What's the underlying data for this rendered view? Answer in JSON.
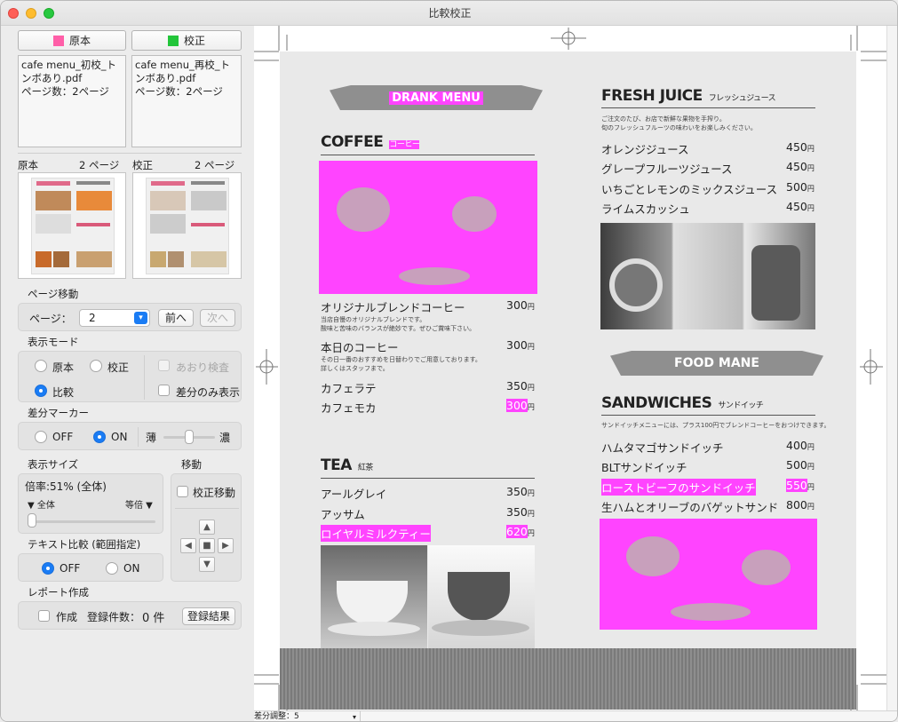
{
  "window": {
    "title": "比較校正"
  },
  "files": {
    "original": {
      "button": "原本",
      "color": "#ff5fa8",
      "name": "cafe menu_初校_トンボあり.pdf",
      "pages": "ページ数：2ページ",
      "thumb_label": "原本",
      "thumb_pages": "2 ページ"
    },
    "revised": {
      "button": "校正",
      "color": "#22c53a",
      "name": "cafe menu_再校_トンボあり.pdf",
      "pages": "ページ数：2ページ",
      "thumb_label": "校正",
      "thumb_pages": "2 ページ"
    }
  },
  "page_move": {
    "title": "ページ移動",
    "label": "ページ：",
    "value": "2",
    "prev": "前へ",
    "next": "次へ"
  },
  "display_mode": {
    "title": "表示モード",
    "original": "原本",
    "revised": "校正",
    "flip": "あおり検査",
    "compare": "比較",
    "diff_only": "差分のみ表示"
  },
  "diff_marker": {
    "title": "差分マーカー",
    "off": "OFF",
    "on": "ON",
    "light": "薄",
    "dark": "濃",
    "level": 0.5
  },
  "display_size": {
    "title": "表示サイズ",
    "zoom": "倍率:51% (全体)",
    "fit": "▼ 全体",
    "actual": "等倍 ▼",
    "level": 0.0
  },
  "move": {
    "title": "移動",
    "revised_move": "校正移動"
  },
  "text_compare": {
    "title": "テキスト比較 (範囲指定)",
    "off": "OFF",
    "on": "ON"
  },
  "report": {
    "title": "レポート作成",
    "create": "作成",
    "count_label": "登録件数：",
    "count": "0 件",
    "result": "登録結果"
  },
  "status": {
    "diff_adjust": "差分調整：5"
  },
  "menu": {
    "drink_banner": "DRANK MENU",
    "coffee": {
      "title": "COFFEE",
      "sub": "コーヒー",
      "items": [
        {
          "name": "オリジナルブレンドコーヒー",
          "price": "300",
          "desc": "当店自慢のオリジナルブレンドです。\n酸味と苦味のバランスが絶妙です。ぜひご賞味下さい。"
        },
        {
          "name": "本日のコーヒー",
          "price": "300",
          "desc": "その日一番のおすすめを日替わりでご用意しております。\n詳しくはスタッフまで。"
        },
        {
          "name": "カフェラテ",
          "price": "350"
        },
        {
          "name": "カフェモカ",
          "price": "300"
        }
      ]
    },
    "tea": {
      "title": "TEA",
      "sub": "紅茶",
      "items": [
        {
          "name": "アールグレイ",
          "price": "350"
        },
        {
          "name": "アッサム",
          "price": "350"
        },
        {
          "name": "ロイヤルミルクティー",
          "price": "620"
        }
      ]
    },
    "juice": {
      "title": "FRESH JUICE",
      "sub": "フレッシュジュース",
      "desc": "ご注文のたび、お店で新鮮な果物を手搾り。\n旬のフレッシュフルーツの味わいをお楽しみください。",
      "items": [
        {
          "name": "オレンジジュース",
          "price": "450"
        },
        {
          "name": "グレープフルーツジュース",
          "price": "450"
        },
        {
          "name": "いちごとレモンのミックスジュース",
          "price": "500"
        },
        {
          "name": "ライムスカッシュ",
          "price": "450"
        }
      ]
    },
    "food_banner": "FOOD MANE",
    "sandwich": {
      "title": "SANDWICHES",
      "sub": "サンドイッチ",
      "desc": "サンドイッチメニューには、プラス100円でブレンドコーヒーをおつけできます。",
      "items": [
        {
          "name": "ハムタマゴサンドイッチ",
          "price": "400"
        },
        {
          "name": "BLTサンドイッチ",
          "price": "500"
        },
        {
          "name": "ローストビーフのサンドイッチ",
          "price": "550"
        },
        {
          "name": "生ハムとオリーブのバゲットサンド",
          "price": "800"
        }
      ]
    },
    "yen": "円"
  }
}
